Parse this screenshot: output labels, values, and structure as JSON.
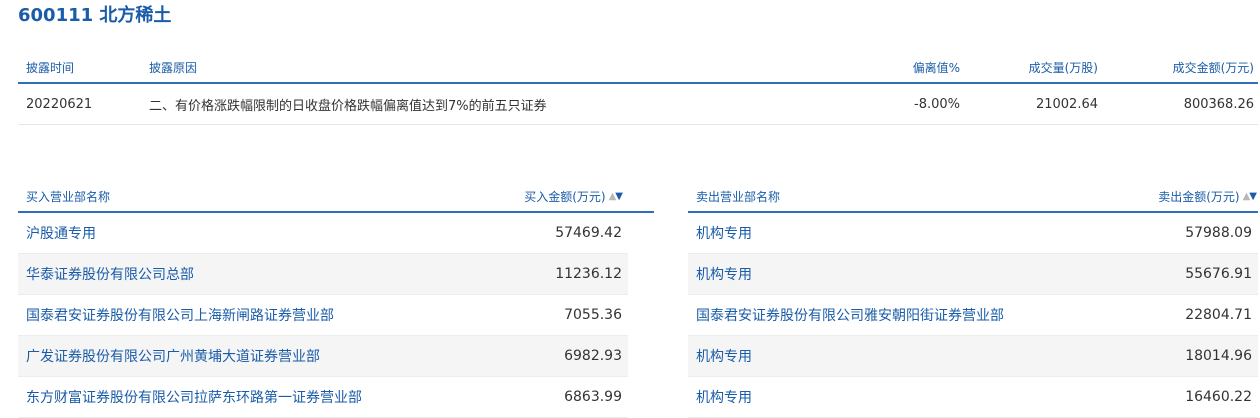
{
  "stock_title": "600111 北方稀土",
  "summary": {
    "headers": {
      "date": "披露时间",
      "reason": "披露原因",
      "deviation": "偏离值%",
      "volume": "成交量(万股)",
      "amount": "成交金额(万元)"
    },
    "row": {
      "date": "20220621",
      "reason": "二、有价格涨跌幅限制的日收盘价格跌幅偏离值达到7%的前五只证券",
      "deviation": "-8.00%",
      "volume": "21002.64",
      "amount": "800368.26"
    }
  },
  "buy": {
    "header_name": "买入营业部名称",
    "header_amount": "买入金额(万元)",
    "rows": [
      {
        "name": "沪股通专用",
        "amount": "57469.42"
      },
      {
        "name": "华泰证券股份有限公司总部",
        "amount": "11236.12"
      },
      {
        "name": "国泰君安证券股份有限公司上海新闸路证券营业部",
        "amount": "7055.36"
      },
      {
        "name": "广发证券股份有限公司广州黄埔大道证券营业部",
        "amount": "6982.93"
      },
      {
        "name": "东方财富证券股份有限公司拉萨东环路第一证券营业部",
        "amount": "6863.99"
      }
    ]
  },
  "sell": {
    "header_name": "卖出营业部名称",
    "header_amount": "卖出金额(万元)",
    "rows": [
      {
        "name": "机构专用",
        "amount": "57988.09"
      },
      {
        "name": "机构专用",
        "amount": "55676.91"
      },
      {
        "name": "国泰君安证券股份有限公司雅安朝阳街证券营业部",
        "amount": "22804.71"
      },
      {
        "name": "机构专用",
        "amount": "18014.96"
      },
      {
        "name": "机构专用",
        "amount": "16460.22"
      }
    ]
  },
  "sort_icons": {
    "up": "sort-asc-icon",
    "down": "sort-desc-icon"
  },
  "colors": {
    "accent": "#1a5ca8",
    "rule": "#2f6eb8",
    "alt_row": "#f5f5f5"
  }
}
